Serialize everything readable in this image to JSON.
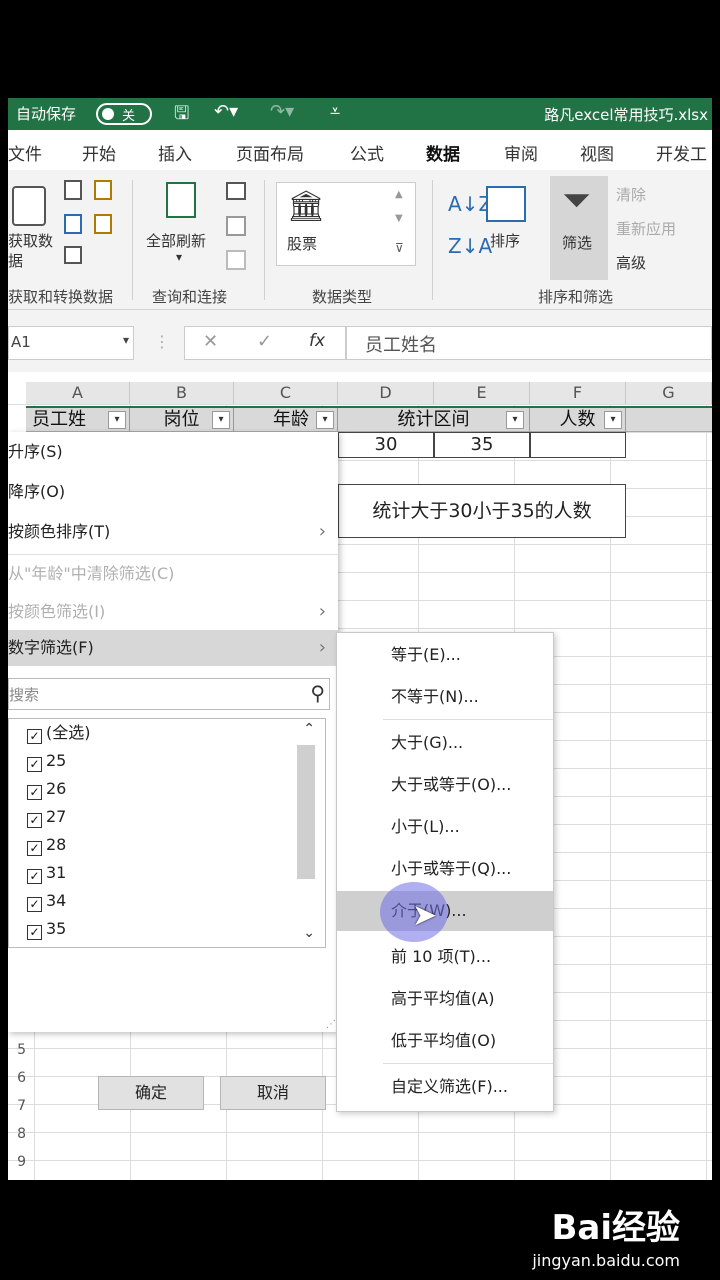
{
  "titlebar": {
    "autosave": "自动保存",
    "toggle_state": "关",
    "filename": "路凡excel常用技巧.xlsx"
  },
  "tabs": [
    "文件",
    "开始",
    "插入",
    "页面布局",
    "公式",
    "数据",
    "审阅",
    "视图",
    "开发工"
  ],
  "ribbon": {
    "get_data": "获取数\n据",
    "get_data_line1": "获取数",
    "get_data_line2": "据",
    "group_get": "获取和转换数据",
    "refresh_all": "全部刷新",
    "group_query": "查询和连接",
    "stocks": "股票",
    "group_datatype": "数据类型",
    "sort": "排序",
    "filter": "筛选",
    "clear": "清除",
    "reapply": "重新应用",
    "advanced": "高级",
    "group_sort_filter": "排序和筛选"
  },
  "formula_bar": {
    "name_box": "A1",
    "formula": "员工姓名"
  },
  "columns": [
    "A",
    "B",
    "C",
    "D",
    "E",
    "F",
    "G"
  ],
  "header_row": {
    "col_a": "员工姓",
    "col_b": "岗位",
    "col_c": "年龄",
    "col_de": "统计区间",
    "col_f": "人数"
  },
  "cells": {
    "d2": "30",
    "e2": "35",
    "note": "统计大于30小于35的人数"
  },
  "row_numbers": [
    "5",
    "6",
    "7",
    "8",
    "9"
  ],
  "filter_panel": {
    "sort_asc": "升序(S)",
    "sort_desc": "降序(O)",
    "sort_by_color": "按颜色排序(T)",
    "clear_filter": "从\"年龄\"中清除筛选(C)",
    "filter_by_color": "按颜色筛选(I)",
    "number_filters": "数字筛选(F)",
    "search_placeholder": "搜索",
    "items": [
      "(全选)",
      "25",
      "26",
      "27",
      "28",
      "31",
      "34",
      "35"
    ],
    "ok": "确定",
    "cancel": "取消"
  },
  "number_filter_menu": {
    "items": [
      "等于(E)...",
      "不等于(N)...",
      "大于(G)...",
      "大于或等于(O)...",
      "小于(L)...",
      "小于或等于(Q)...",
      "介于(W)...",
      "前 10 项(T)...",
      "高于平均值(A)",
      "低于平均值(O)",
      "自定义筛选(F)..."
    ],
    "highlighted": "介于(W)..."
  },
  "watermark": {
    "logo": "Bai经验",
    "site": "jingyan.baidu.com"
  }
}
